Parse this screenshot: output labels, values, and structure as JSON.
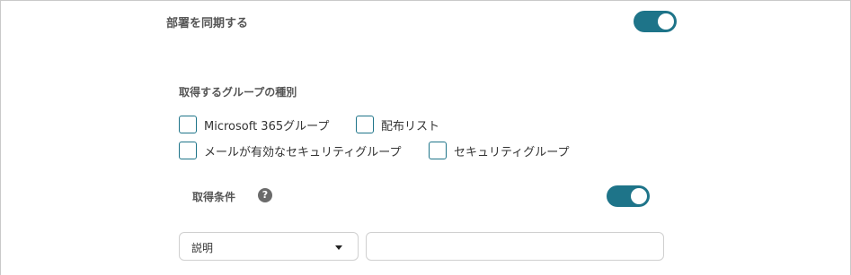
{
  "sync_departments": {
    "label": "部署を同期する",
    "enabled": true
  },
  "group_types": {
    "heading": "取得するグループの種別",
    "options": [
      {
        "label": "Microsoft 365グループ",
        "checked": false
      },
      {
        "label": "配布リスト",
        "checked": false
      },
      {
        "label": "メールが有効なセキュリティグループ",
        "checked": false
      },
      {
        "label": "セキュリティグループ",
        "checked": false
      }
    ]
  },
  "conditions": {
    "label": "取得条件",
    "help_icon": "?",
    "enabled": true,
    "field_select": {
      "value": "説明"
    },
    "value_input": {
      "value": "",
      "placeholder": ""
    }
  },
  "colors": {
    "accent": "#1e7489",
    "help_icon": "#6b6b6b",
    "border": "#d0d0d0"
  }
}
